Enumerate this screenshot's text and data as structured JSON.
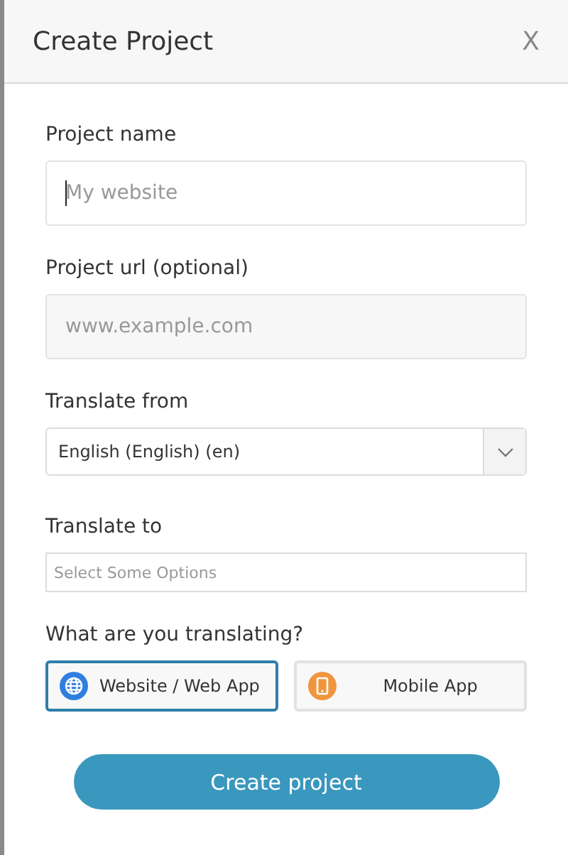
{
  "dialog": {
    "title": "Create Project",
    "close": "X"
  },
  "fields": [
    {
      "kind": "text",
      "label": "Project name",
      "placeholder": "My website",
      "focused": true
    },
    {
      "kind": "text",
      "label": "Project url (optional)",
      "placeholder": "www.example.com",
      "focused": false
    },
    {
      "kind": "select",
      "label": "Translate from",
      "value": "English (English) (en)"
    },
    {
      "kind": "multiselect",
      "label": "Translate to",
      "placeholder": "Select Some Options"
    }
  ],
  "question": "What are you translating?",
  "options": [
    {
      "kind": "website",
      "label": "Website / Web App",
      "selected": true
    },
    {
      "kind": "mobile",
      "label": "Mobile App",
      "selected": false
    }
  ],
  "submit": "Create project"
}
